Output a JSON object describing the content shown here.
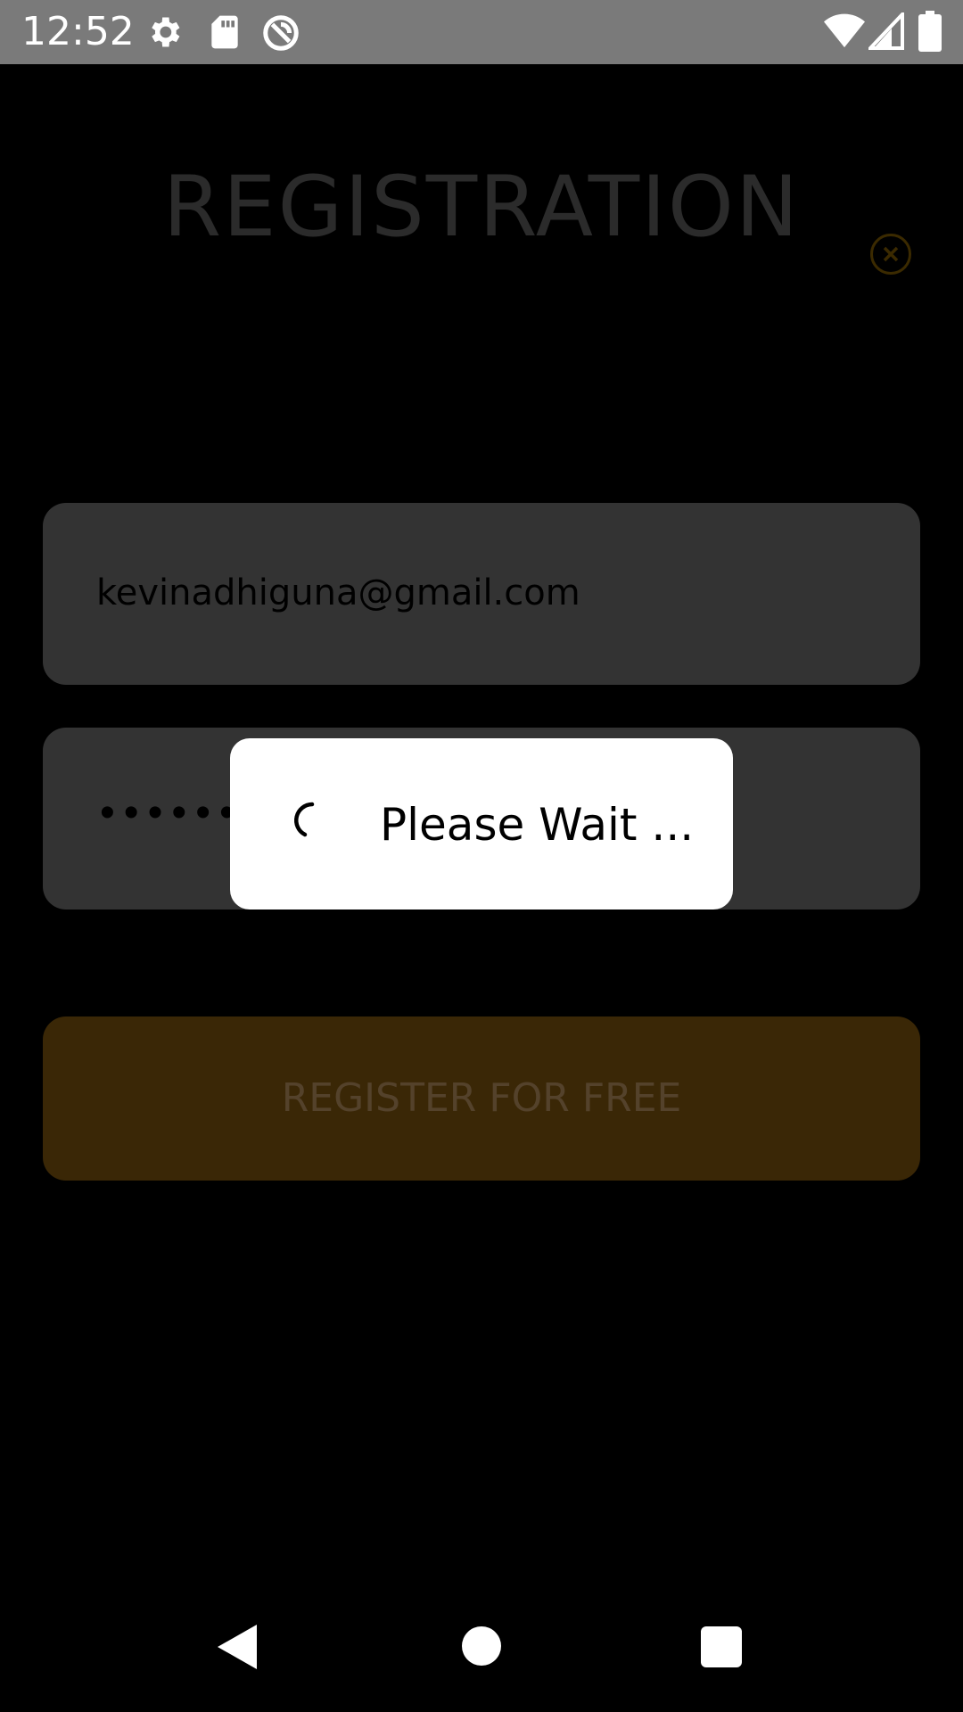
{
  "status_bar": {
    "time": "12:52",
    "icons": [
      "gear-icon",
      "sd-card-icon",
      "data-saver-icon",
      "wifi-icon",
      "cell-signal-icon",
      "battery-icon"
    ]
  },
  "screen": {
    "title": "REGISTRATION",
    "email_value": "kevinadhiguna@gmail.com",
    "password_mask": "••••••",
    "register_label": "REGISTER FOR FREE",
    "close_icon": "close-circle-icon"
  },
  "dialog": {
    "message": "Please Wait ...",
    "spinner_icon": "spinner-icon"
  },
  "nav_bar": {
    "icons": [
      "back-icon",
      "home-icon",
      "recents-icon"
    ]
  },
  "colors": {
    "accent": "#F5A623",
    "status_bar": "#7A7A7A",
    "background": "#000000"
  }
}
